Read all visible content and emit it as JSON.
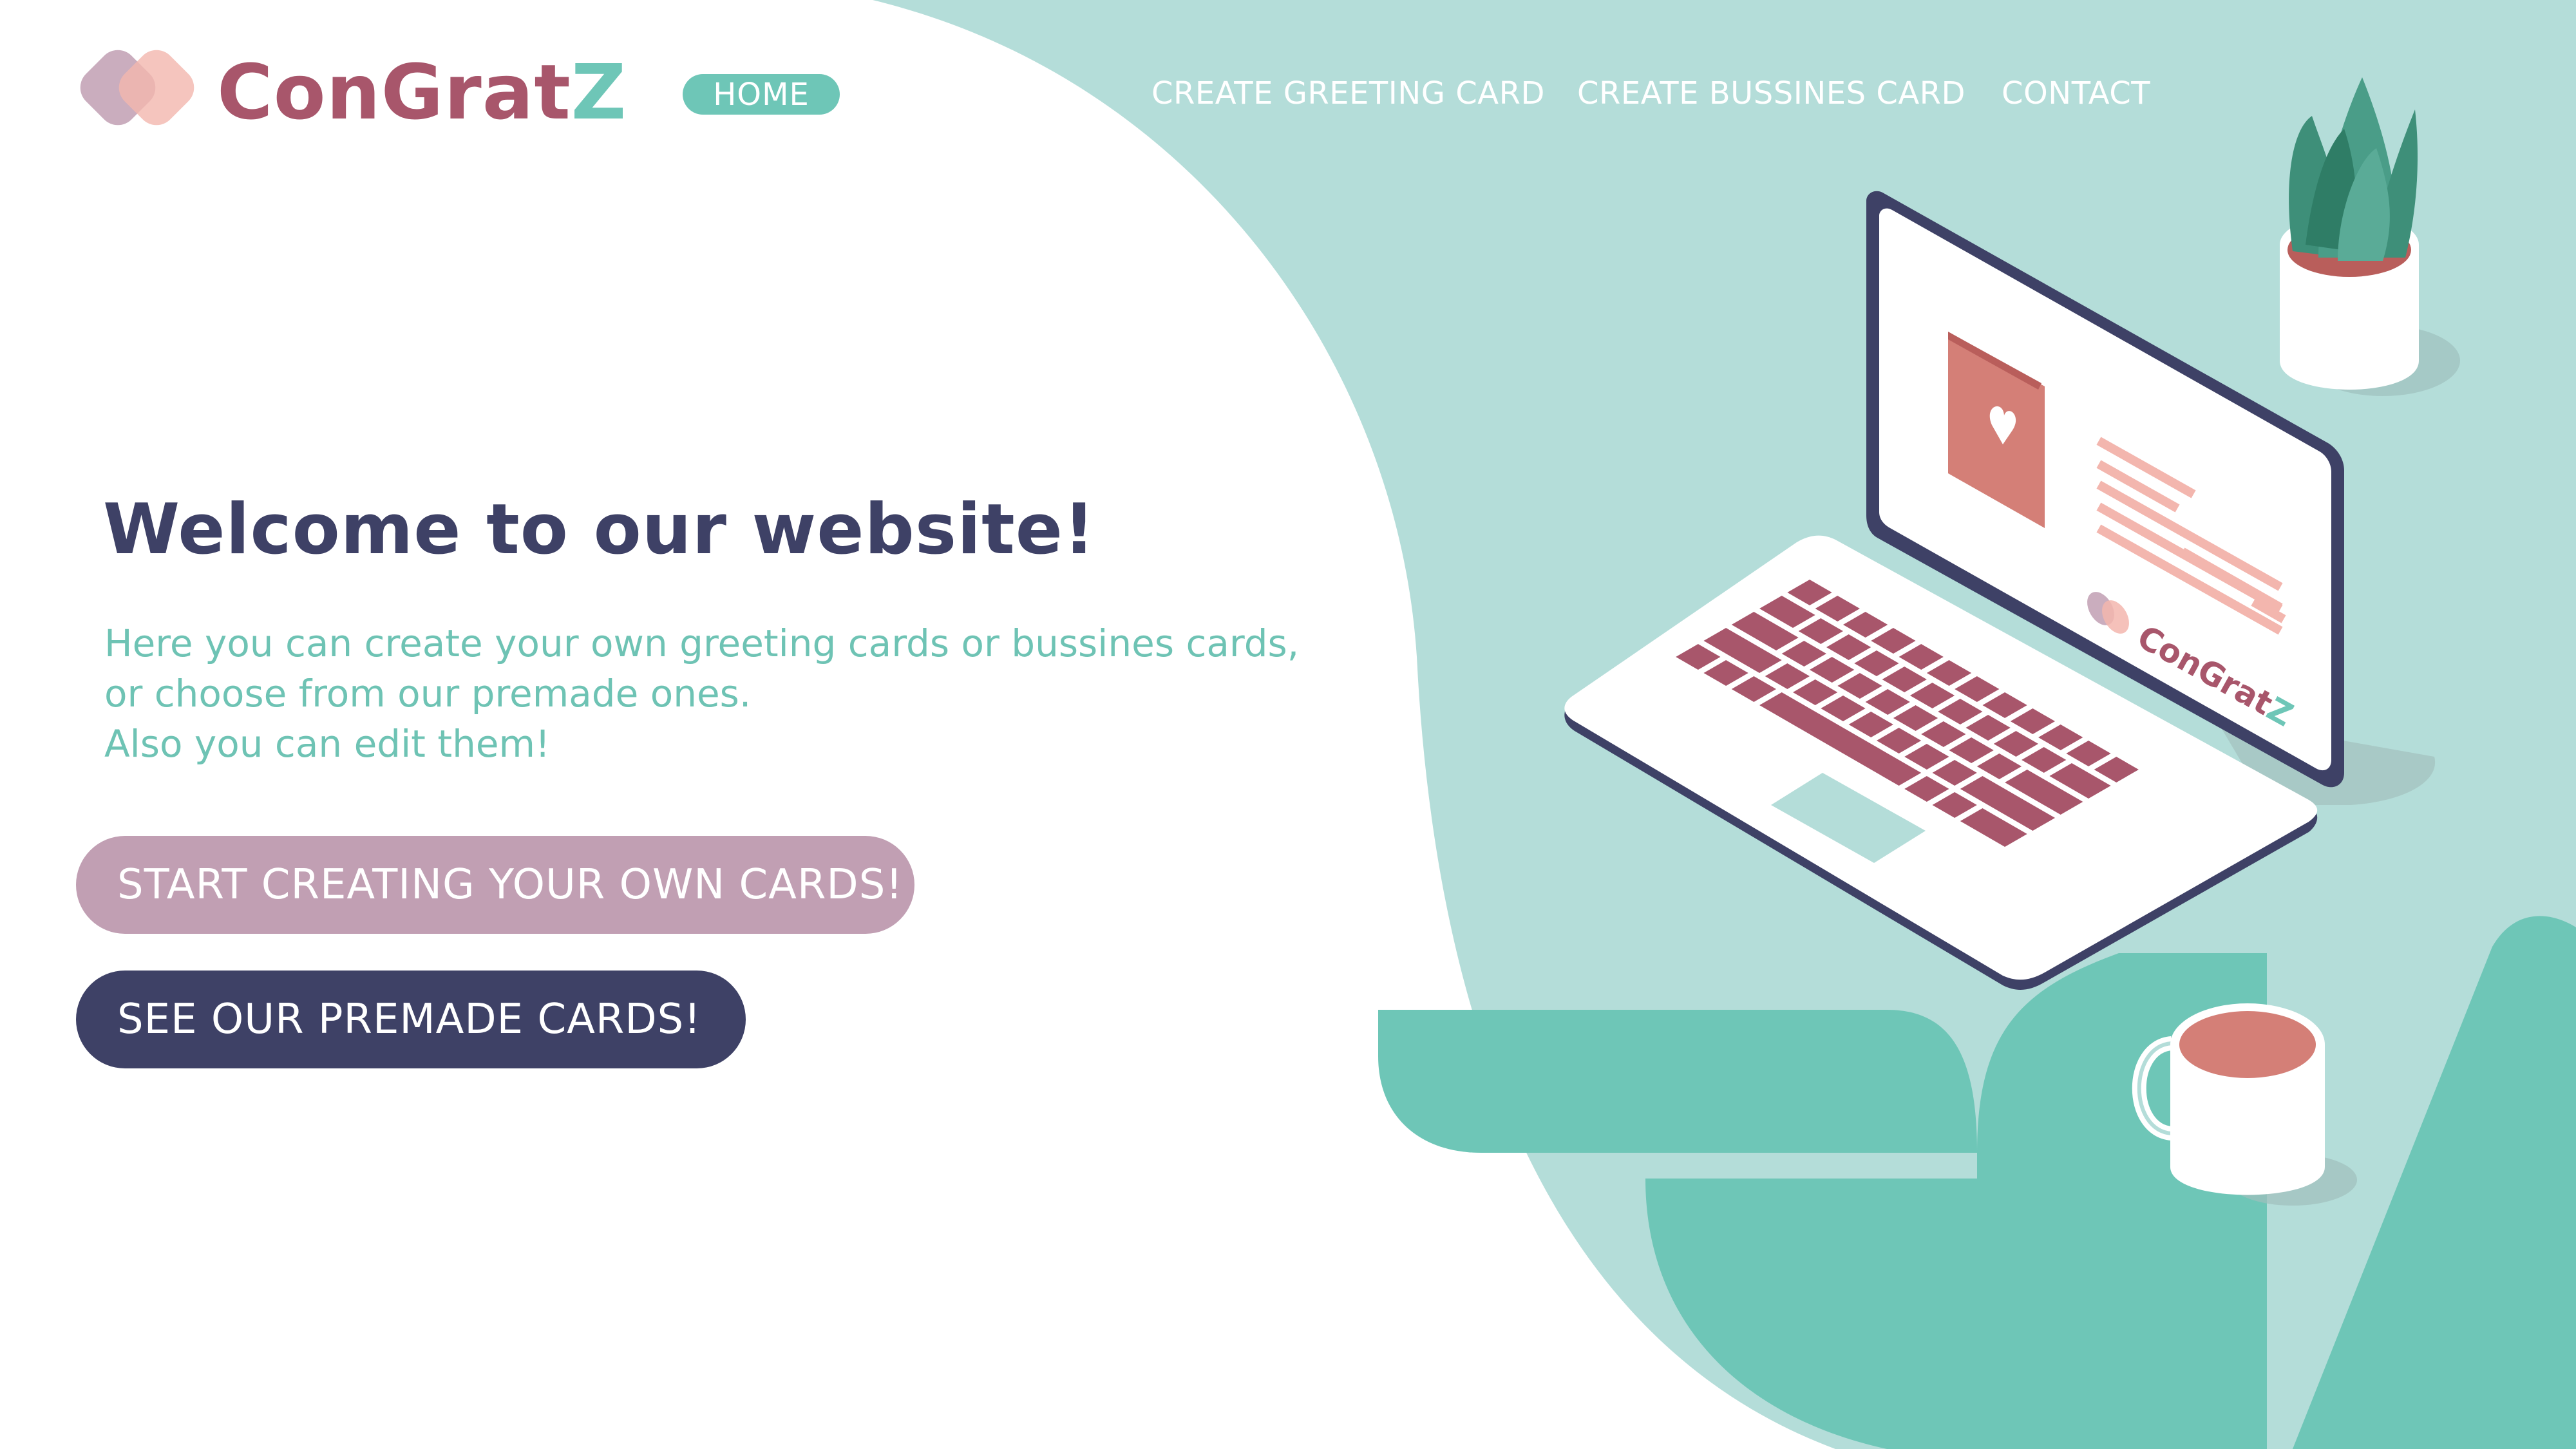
{
  "colors": {
    "mint_bg": "#b4ddd9",
    "teal": "#6ec6b7",
    "navy": "#3e4166",
    "mauve": "#c19fb3",
    "brand_rose": "#a8566b",
    "coral": "#d47f77",
    "pink_light": "#f3b6ae"
  },
  "brand": {
    "name_main": "ConGrat",
    "name_accent": "Z",
    "screen_logo_main": "ConGrat",
    "screen_logo_accent": "Z"
  },
  "nav": {
    "home": "HOME",
    "items": [
      {
        "label": "CREATE GREETING CARD"
      },
      {
        "label": "CREATE BUSSINES CARD"
      },
      {
        "label": "CONTACT"
      }
    ]
  },
  "hero": {
    "headline": "Welcome to our website!",
    "lines": [
      "Here you can create your own greeting cards or bussines cards,",
      "or choose from our premade ones.",
      "Also you can edit them!"
    ],
    "cta_primary": "START CREATING YOUR OWN CARDS!",
    "cta_secondary": "SEE OUR PREMADE CARDS!"
  },
  "illustration": {
    "icons": [
      "laptop-icon",
      "plant-icon",
      "mug-icon",
      "heart-card-icon",
      "armchair-icon"
    ]
  }
}
